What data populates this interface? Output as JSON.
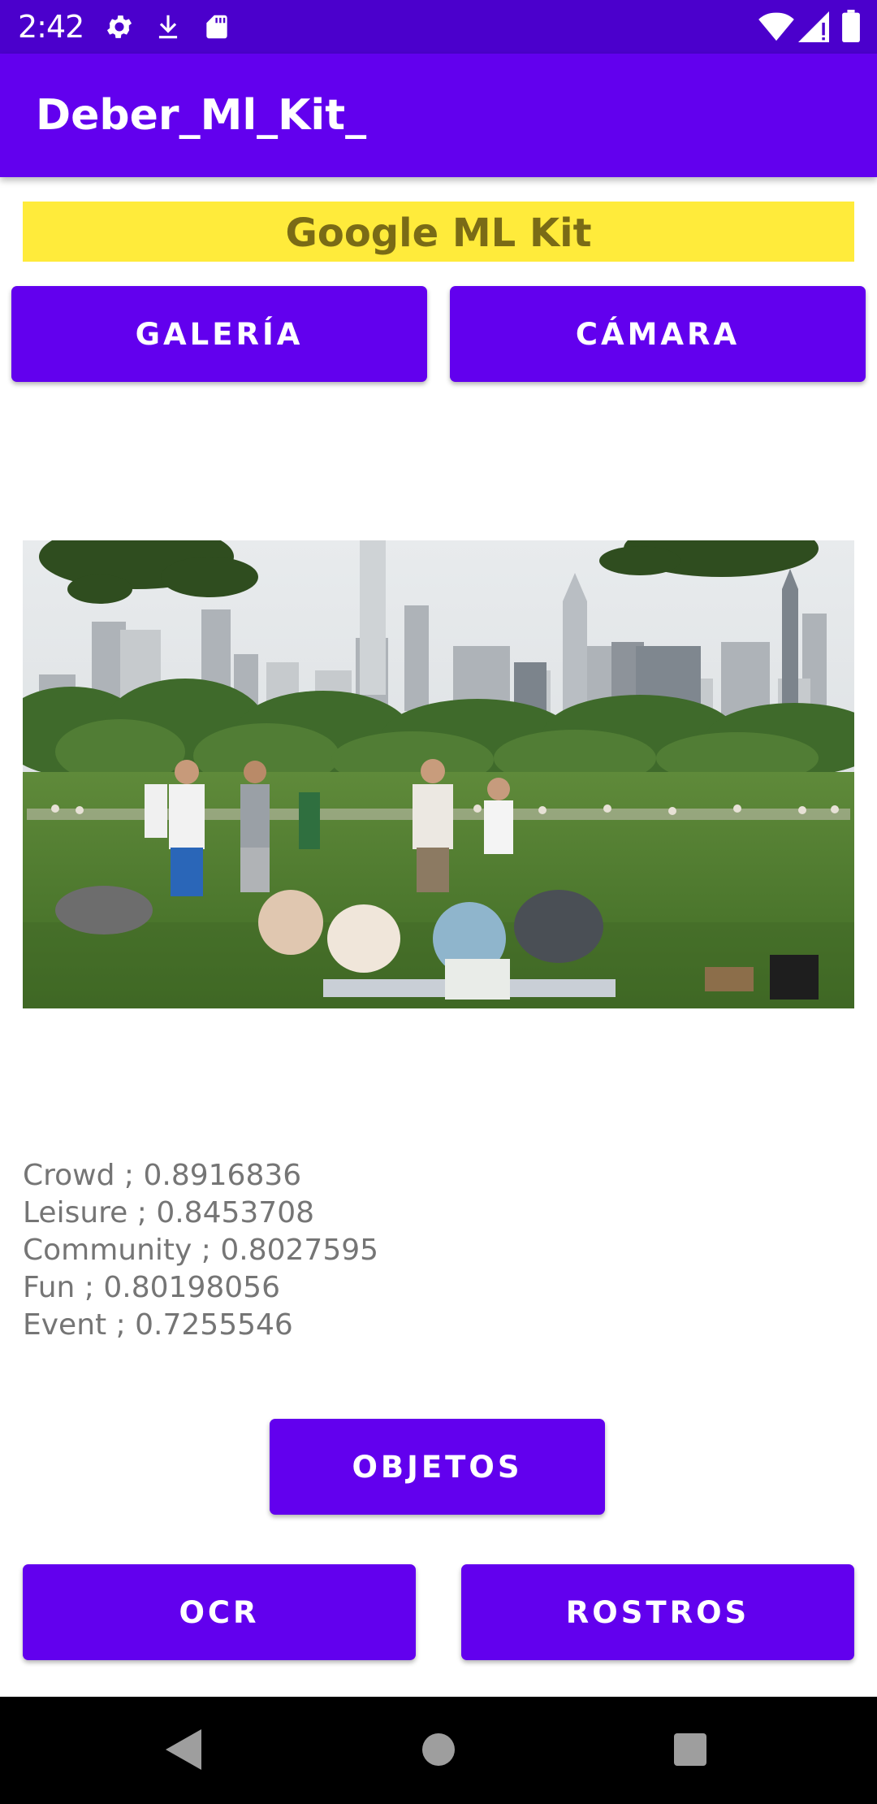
{
  "status_bar": {
    "time": "2:42",
    "icons": [
      "gear-icon",
      "download-icon",
      "sd-card-icon",
      "wifi-icon",
      "signal-icon",
      "battery-icon"
    ]
  },
  "app_bar": {
    "title": "Deber_Ml_Kit_"
  },
  "banner": {
    "text": "Google ML Kit"
  },
  "buttons": {
    "gallery": "GALERÍA",
    "camera": "CÁMARA",
    "objects": "OBJETOS",
    "ocr": "OCR",
    "faces": "ROSTROS"
  },
  "results": [
    "Crowd ; 0.8916836",
    "Leisure ; 0.8453708",
    "Community ; 0.8027595",
    "Fun ; 0.80198056",
    "Event ; 0.7255546"
  ],
  "nav_bar": {
    "icons": [
      "back-icon",
      "home-icon",
      "recents-icon"
    ]
  },
  "colors": {
    "primary": "#6200ee",
    "primary_dark": "#4b00cc",
    "banner_bg": "#ffeb3b",
    "banner_text": "#7a6b16",
    "result_text": "#757575"
  }
}
